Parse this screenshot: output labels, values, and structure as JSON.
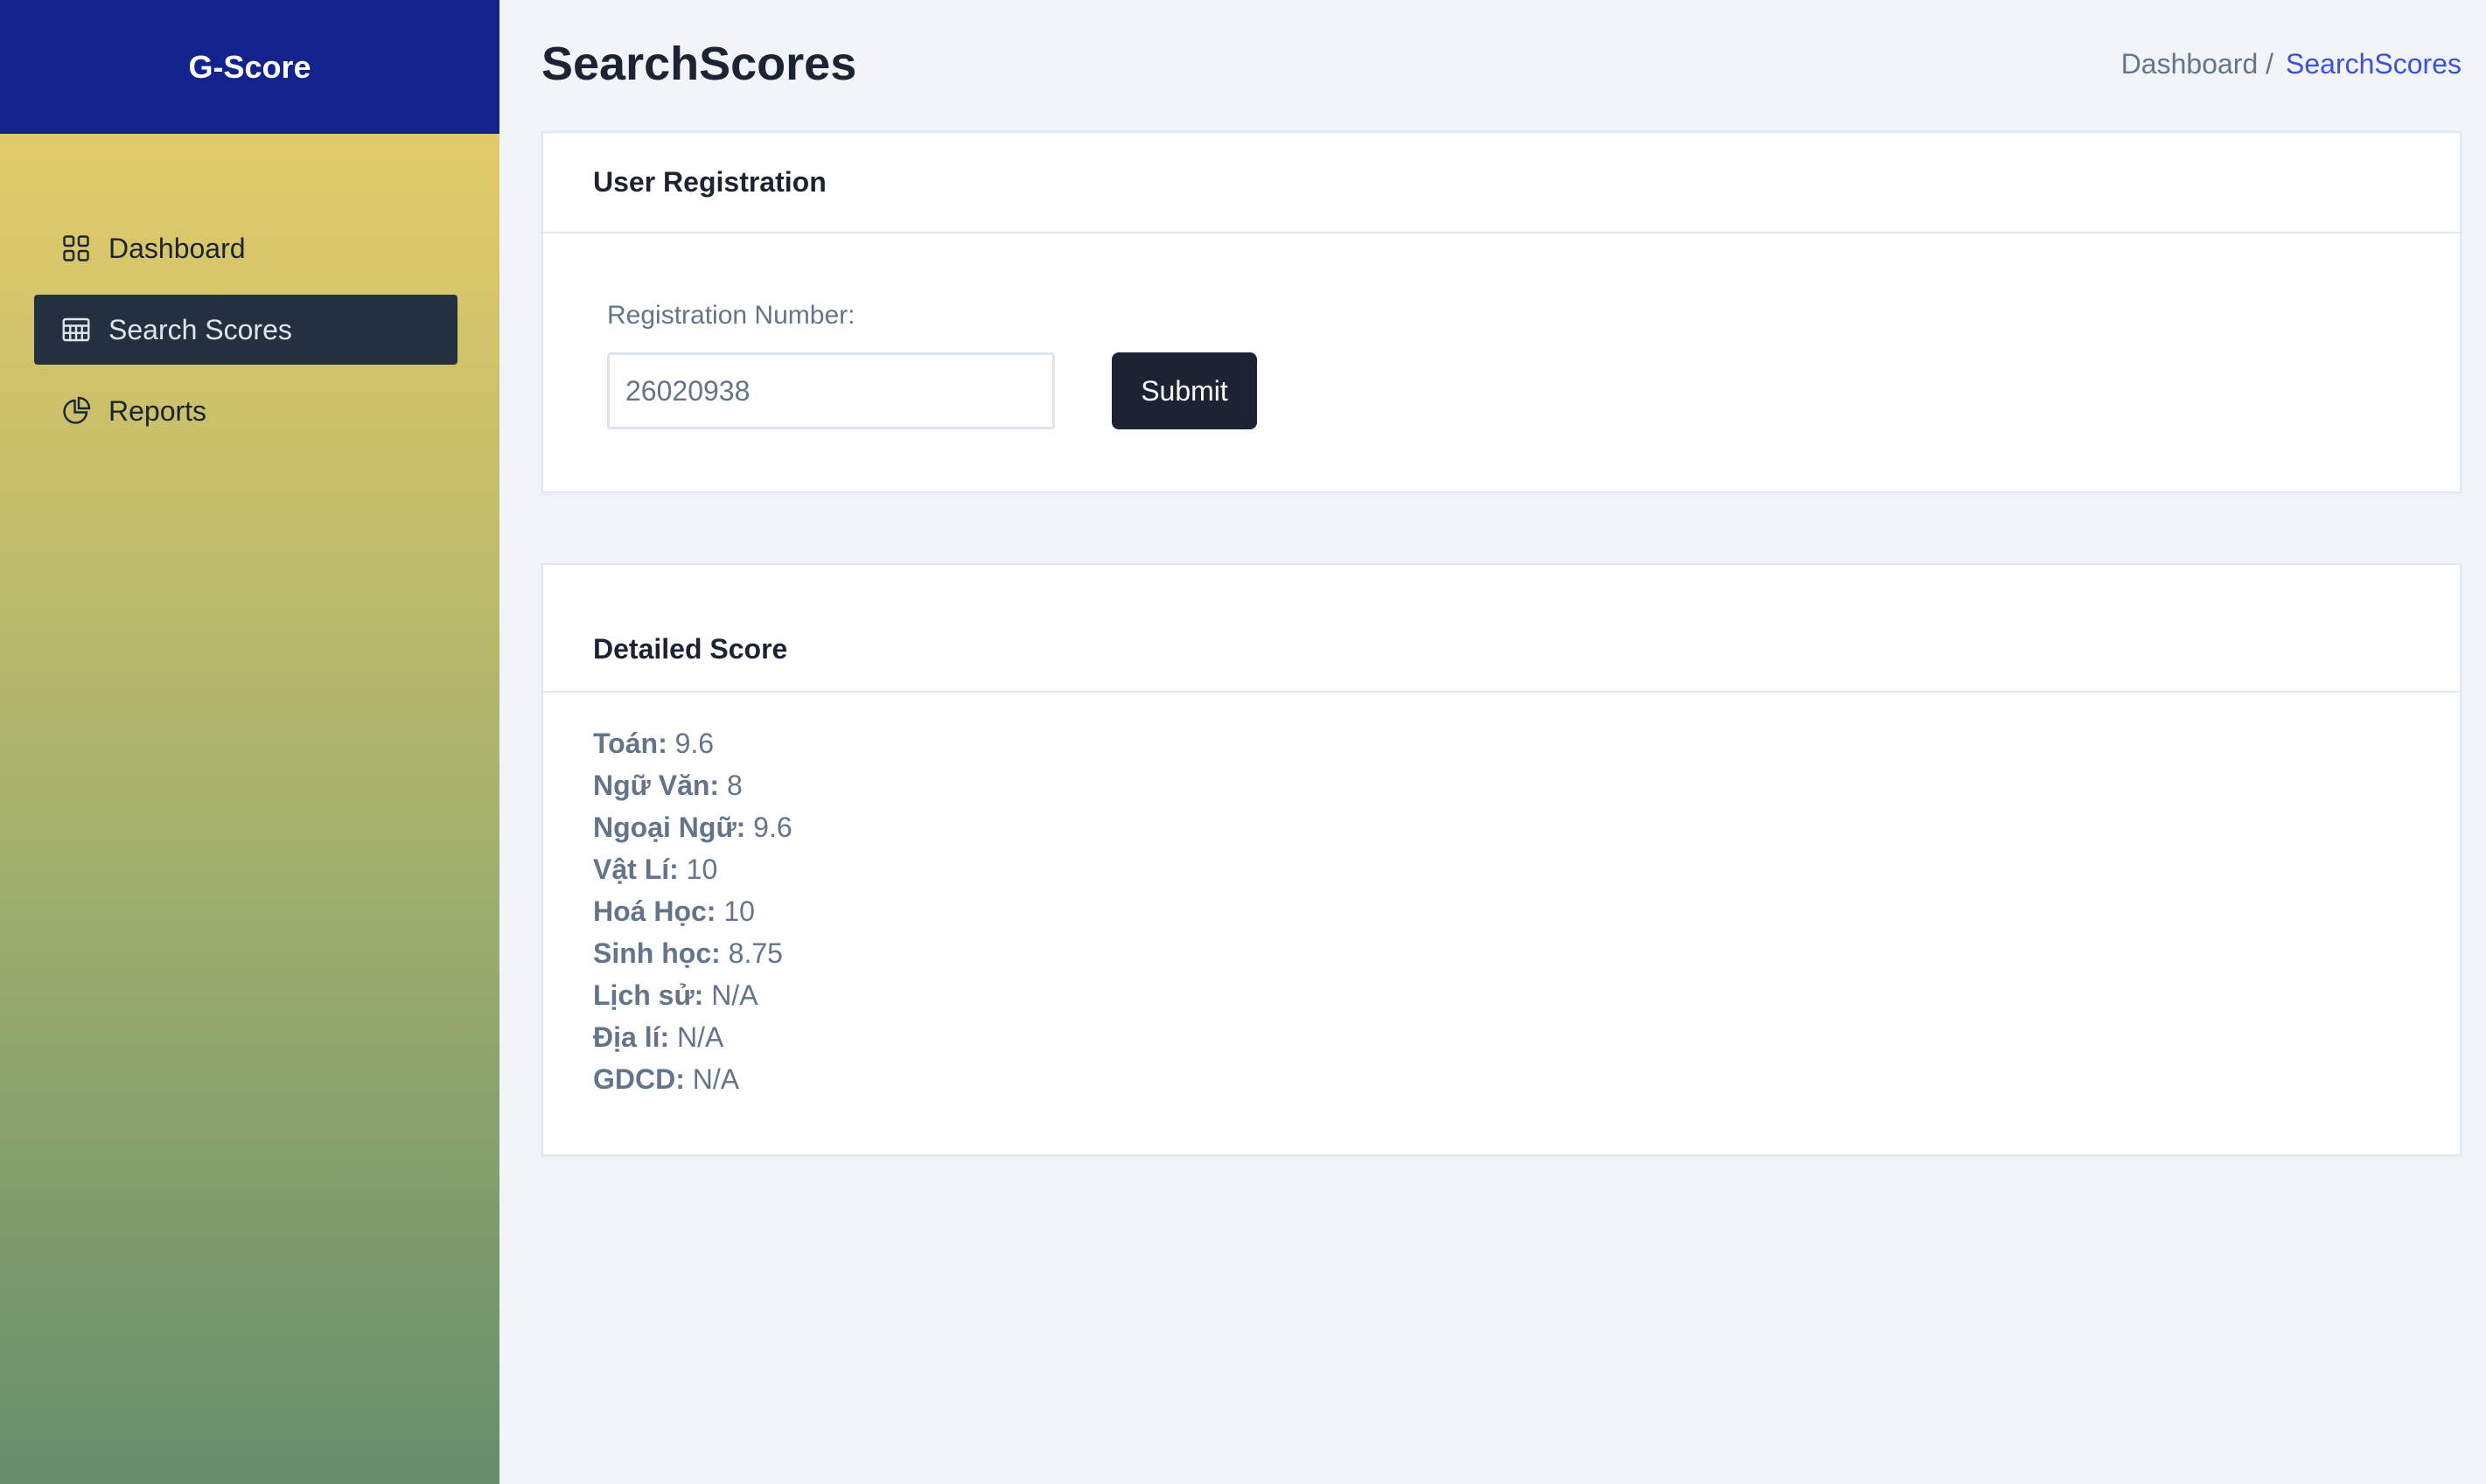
{
  "brand": "G-Score",
  "sidebar": {
    "items": [
      {
        "label": "Dashboard",
        "icon": "grid-icon",
        "active": false
      },
      {
        "label": "Search Scores",
        "icon": "calendar-icon",
        "active": true
      },
      {
        "label": "Reports",
        "icon": "pie-chart-icon",
        "active": false
      }
    ]
  },
  "header": {
    "title": "SearchScores",
    "breadcrumb": {
      "parent": "Dashboard /",
      "current": "SearchScores"
    }
  },
  "registration": {
    "title": "User Registration",
    "label": "Registration Number:",
    "value": "26020938",
    "submit_label": "Submit"
  },
  "scores": {
    "title": "Detailed Score",
    "rows": [
      {
        "subject": "Toán:",
        "value": "9.6"
      },
      {
        "subject": "Ngữ Văn:",
        "value": "8"
      },
      {
        "subject": "Ngoại Ngữ:",
        "value": "9.6"
      },
      {
        "subject": "Vật Lí:",
        "value": "10"
      },
      {
        "subject": "Hoá Học:",
        "value": "10"
      },
      {
        "subject": "Sinh học:",
        "value": "8.75"
      },
      {
        "subject": "Lịch sử:",
        "value": "N/A"
      },
      {
        "subject": "Địa lí:",
        "value": "N/A"
      },
      {
        "subject": "GDCD:",
        "value": "N/A"
      }
    ]
  },
  "colors": {
    "brand_bg": "#13238e",
    "active_nav": "#24303f",
    "accent": "#3c50e0",
    "button": "#1c2434"
  }
}
